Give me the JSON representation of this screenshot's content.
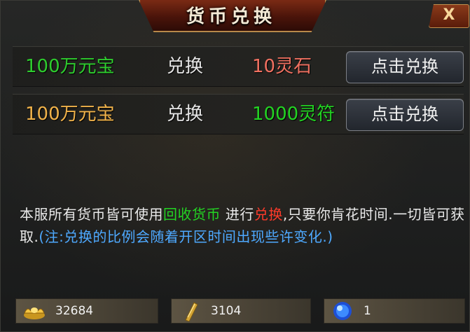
{
  "window": {
    "title": "货币兑换",
    "close_label": "X"
  },
  "colors": {
    "green": "#2ecc2e",
    "light_green": "#23d423",
    "orange": "#f0b24a",
    "red": "#f07060",
    "highlight_red": "#ff3a2a",
    "blue": "#4ea9ff"
  },
  "exchanges": [
    {
      "from": "100万元宝",
      "action": "兑换",
      "to": "10灵石",
      "button": "点击兑换"
    },
    {
      "from": "100万元宝",
      "action": "兑换",
      "to": "1000灵符",
      "button": "点击兑换"
    }
  ],
  "description": {
    "part1": "本服所有货币皆可使用",
    "link": "回收货币",
    "part2": " 进行",
    "highlight": "兑换",
    "part3": ",只要你肯花时间.一切皆可获取.",
    "note": "(注:兑换的比例会随着开区时间出现些许变化.)"
  },
  "resources": [
    {
      "icon": "gold-ingot-icon",
      "value": "32684"
    },
    {
      "icon": "jade-talisman-icon",
      "value": "3104"
    },
    {
      "icon": "spirit-orb-icon",
      "value": "1"
    }
  ]
}
